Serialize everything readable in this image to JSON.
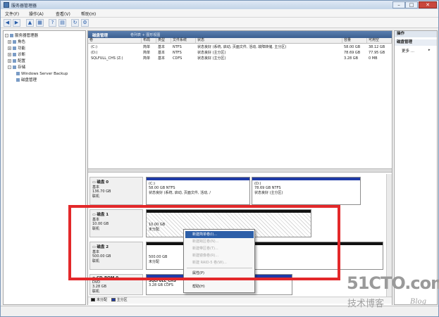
{
  "window": {
    "title": "服务器管理器"
  },
  "menu": [
    "文件(F)",
    "操作(A)",
    "查看(V)",
    "帮助(H)"
  ],
  "tree": {
    "items": [
      {
        "label": "服务器管理器",
        "level": 0,
        "expander": "-"
      },
      {
        "label": "角色",
        "level": 1,
        "expander": "+"
      },
      {
        "label": "功能",
        "level": 1,
        "expander": "+"
      },
      {
        "label": "诊断",
        "level": 1,
        "expander": "+"
      },
      {
        "label": "配置",
        "level": 1,
        "expander": "+"
      },
      {
        "label": "存储",
        "level": 1,
        "expander": "-"
      },
      {
        "label": "Windows Server Backup",
        "level": 2,
        "expander": ""
      },
      {
        "label": "磁盘管理",
        "level": 2,
        "expander": ""
      }
    ]
  },
  "center": {
    "tab_title": "磁盘管理",
    "tab_sub": "卷列表 + 图形视图",
    "columns": [
      "卷",
      "布局",
      "类型",
      "文件系统",
      "状态",
      "容量",
      "可用空"
    ],
    "volumes": [
      {
        "vol": "(C:)",
        "layout": "简单",
        "type": "基本",
        "fs": "NTFS",
        "status": "状态良好 (系统, 启动, 页面文件, 活动, 故障转储, 主分区)",
        "capacity": "58.00 GB",
        "free": "38.12 GB"
      },
      {
        "vol": "(D:)",
        "layout": "简单",
        "type": "基本",
        "fs": "NTFS",
        "status": "状态良好 (主分区)",
        "capacity": "78.69 GB",
        "free": "77.95 GB"
      },
      {
        "vol": "SQLFULL_CHS (Z:)",
        "layout": "简单",
        "type": "基本",
        "fs": "CDFS",
        "status": "状态良好 (主分区)",
        "capacity": "3.28 GB",
        "free": "0 MB"
      }
    ]
  },
  "disks": [
    {
      "name": "磁盘 0",
      "kind": "基本",
      "size": "136.70 GB",
      "state": "联机",
      "partitions": [
        {
          "label": "(C:)",
          "line2": "58.00 GB NTFS",
          "line3": "状态良好 (系统, 启动, 页面文件, 活动, /"
        },
        {
          "label": "(D:)",
          "line2": "78.69 GB NTFS",
          "line3": "状态良好 (主分区)"
        }
      ]
    },
    {
      "name": "磁盘 1",
      "kind": "基本",
      "size": "10.00 GB",
      "state": "联机",
      "partitions": [
        {
          "label": "",
          "line2": "10.00 GB",
          "line3": "未分配"
        }
      ]
    },
    {
      "name": "磁盘 2",
      "kind": "基本",
      "size": "500.00 GB",
      "state": "联机",
      "partitions": [
        {
          "label": "",
          "line2": "500.00 GB",
          "line3": "未分配"
        }
      ]
    },
    {
      "name": "CD-ROM 0",
      "kind": "DVD",
      "size": "3.28 GB",
      "state": "联机",
      "partitions": [
        {
          "label": "SQLFULL_CHS",
          "line2": "3.28 GB CDFS",
          "line3": ""
        }
      ]
    }
  ],
  "legend": [
    "未分配",
    "主分区"
  ],
  "actions": {
    "header": "操作",
    "section": "磁盘管理",
    "more": "更多 ..."
  },
  "context_menu": [
    {
      "label": "新建简单卷(I)...",
      "state": "highlighted"
    },
    {
      "label": "新建跨区卷(N)...",
      "state": "disabled"
    },
    {
      "label": "新建带区卷(T)...",
      "state": "disabled"
    },
    {
      "label": "新建镜像卷(R)...",
      "state": "disabled"
    },
    {
      "label": "新建 RAID-5 卷(W)...",
      "state": "disabled"
    },
    {
      "label": "属性(P)",
      "state": "normal"
    },
    {
      "label": "帮助(H)",
      "state": "normal"
    }
  ],
  "watermark": {
    "site": "51CTO.com",
    "tagline": "技术博客",
    "blog": "Blog"
  },
  "colors": {
    "highlight": "#e3282a",
    "primary_partition": "#1f3aa6",
    "unallocated": "#111111",
    "menu_highlight": "#2d5fa8"
  }
}
